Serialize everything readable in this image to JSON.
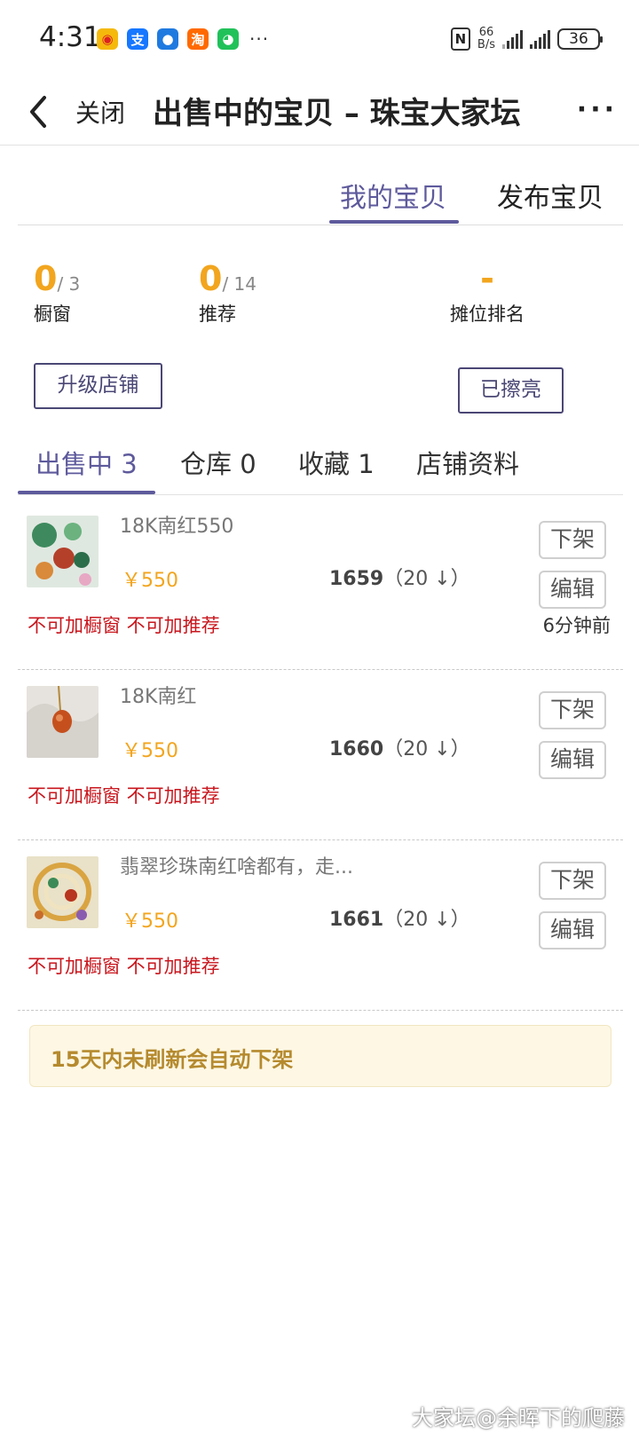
{
  "status_bar": {
    "time": "4:31",
    "app_icons": [
      {
        "name": "weibo-icon",
        "glyph": "◉",
        "color": "#f5b90c"
      },
      {
        "name": "alipay-icon",
        "glyph": "支",
        "color": "#1677ff"
      },
      {
        "name": "qq-icon",
        "glyph": "●",
        "color": "#1f7ae0"
      },
      {
        "name": "taobao-icon",
        "glyph": "淘",
        "color": "#ff6a00"
      },
      {
        "name": "wechat-icon",
        "glyph": "◕",
        "color": "#21c15a"
      }
    ],
    "more": "···",
    "nfc": "N",
    "net_speed_value": "66",
    "net_speed_unit": "B/s",
    "battery": "36"
  },
  "nav": {
    "close_label": "关闭",
    "title": "出售中的宝贝 – 珠宝大家坛",
    "more": "···"
  },
  "top_tabs": [
    {
      "label": "我的宝贝",
      "active": true
    },
    {
      "label": "发布宝贝",
      "active": false
    }
  ],
  "stats": {
    "window": {
      "value": "0",
      "total": "/ 3",
      "label": "橱窗"
    },
    "recommend": {
      "value": "0",
      "total": "/ 14",
      "label": "推荐"
    },
    "rank": {
      "value": "-",
      "label": "摊位排名"
    }
  },
  "buttons": {
    "upgrade": "升级店铺",
    "polished": "已擦亮"
  },
  "section_tabs": [
    {
      "label": "出售中 3",
      "active": true
    },
    {
      "label": "仓库 0",
      "active": false
    },
    {
      "label": "收藏 1",
      "active": false
    },
    {
      "label": "店铺资料",
      "active": false
    }
  ],
  "items": [
    {
      "title": "18K南红550",
      "price": "￥550",
      "rank": "1659",
      "rank_change": "（20 ↓）",
      "warn": "不可加橱窗 不可加推荐",
      "time": "6分钟前",
      "btn_off": "下架",
      "btn_edit": "编辑"
    },
    {
      "title": "18K南红",
      "price": "￥550",
      "rank": "1660",
      "rank_change": "（20 ↓）",
      "warn": "不可加橱窗 不可加推荐",
      "time": "",
      "btn_off": "下架",
      "btn_edit": "编辑"
    },
    {
      "title": "翡翠珍珠南红啥都有，走...",
      "price": "￥550",
      "rank": "1661",
      "rank_change": "（20 ↓）",
      "warn": "不可加橱窗 不可加推荐",
      "time": "",
      "btn_off": "下架",
      "btn_edit": "编辑"
    }
  ],
  "notice": "15天内未刷新会自动下架",
  "watermark": "大家坛@余晖下的爬藤",
  "colors": {
    "accent": "#5e5a9c",
    "orange": "#f2a51e",
    "warn_red": "#c8161d",
    "notice_bg": "#fdf7e4"
  }
}
